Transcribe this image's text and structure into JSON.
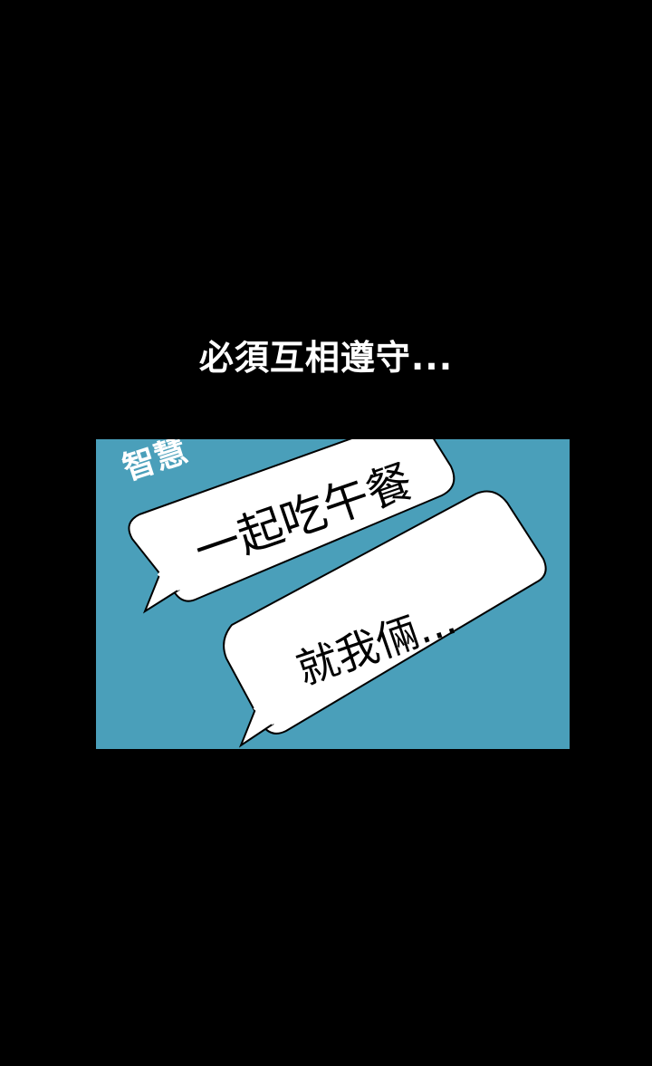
{
  "caption": "必須互相遵守...",
  "panel": {
    "background_color": "#4a9fba",
    "speaker_label": "智慧",
    "bubble_1_text": "一起吃午餐",
    "bubble_2_text": "就我倆..."
  }
}
